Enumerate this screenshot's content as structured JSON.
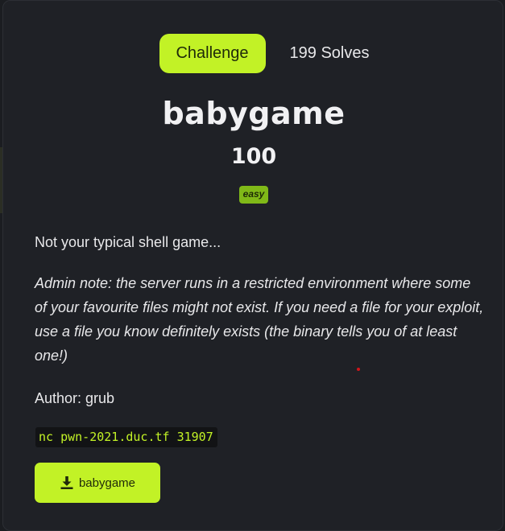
{
  "tabs": {
    "challenge_label": "Challenge",
    "solves_label": "199 Solves"
  },
  "challenge": {
    "name": "babygame",
    "points": "100",
    "difficulty": "easy",
    "description_line": "Not your typical shell game...",
    "admin_note": "Admin note: the server runs in a restricted environment where some of your favourite files might not exist. If you need a file for your exploit, use a file you know definitely exists (the binary tells you of at least one!)",
    "author": "Author: grub",
    "connection": "nc pwn-2021.duc.tf 31907",
    "download_label": "babygame"
  },
  "colors": {
    "accent": "#c2f226",
    "badge": "#80b918",
    "panel": "#1f2126",
    "background": "#1b1d21"
  },
  "icons": {
    "download": "download-icon"
  }
}
